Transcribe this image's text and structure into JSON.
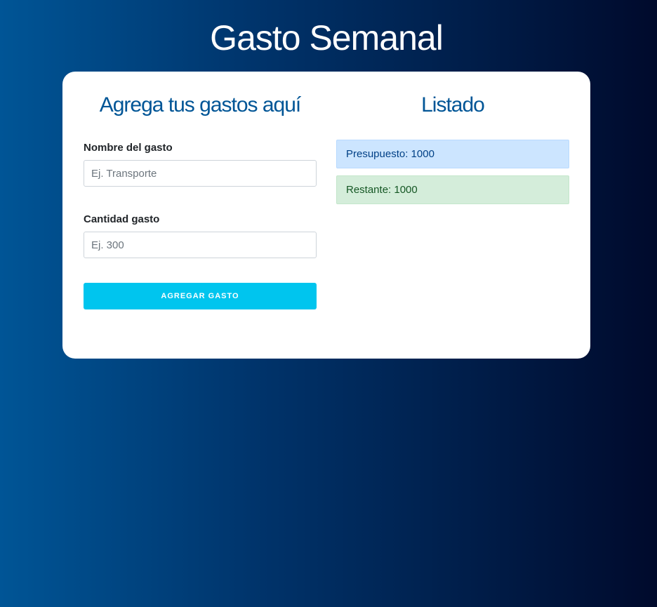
{
  "header": {
    "title": "Gasto Semanal"
  },
  "form": {
    "title": "Agrega tus gastos aquí",
    "name_label": "Nombre del gasto",
    "name_placeholder": "Ej. Transporte",
    "name_value": "",
    "amount_label": "Cantidad gasto",
    "amount_placeholder": "Ej. 300",
    "amount_value": "",
    "submit_label": "Agregar Gasto"
  },
  "listing": {
    "title": "Listado",
    "budget_text": "Presupuesto: 1000",
    "remaining_text": "Restante: 1000"
  },
  "colors": {
    "background_left": "#005596",
    "background_right": "#000a2c",
    "accent": "#005596",
    "button": "#00c5ee",
    "budget_alert": "#cce5ff",
    "remaining_alert": "#d4edda"
  }
}
